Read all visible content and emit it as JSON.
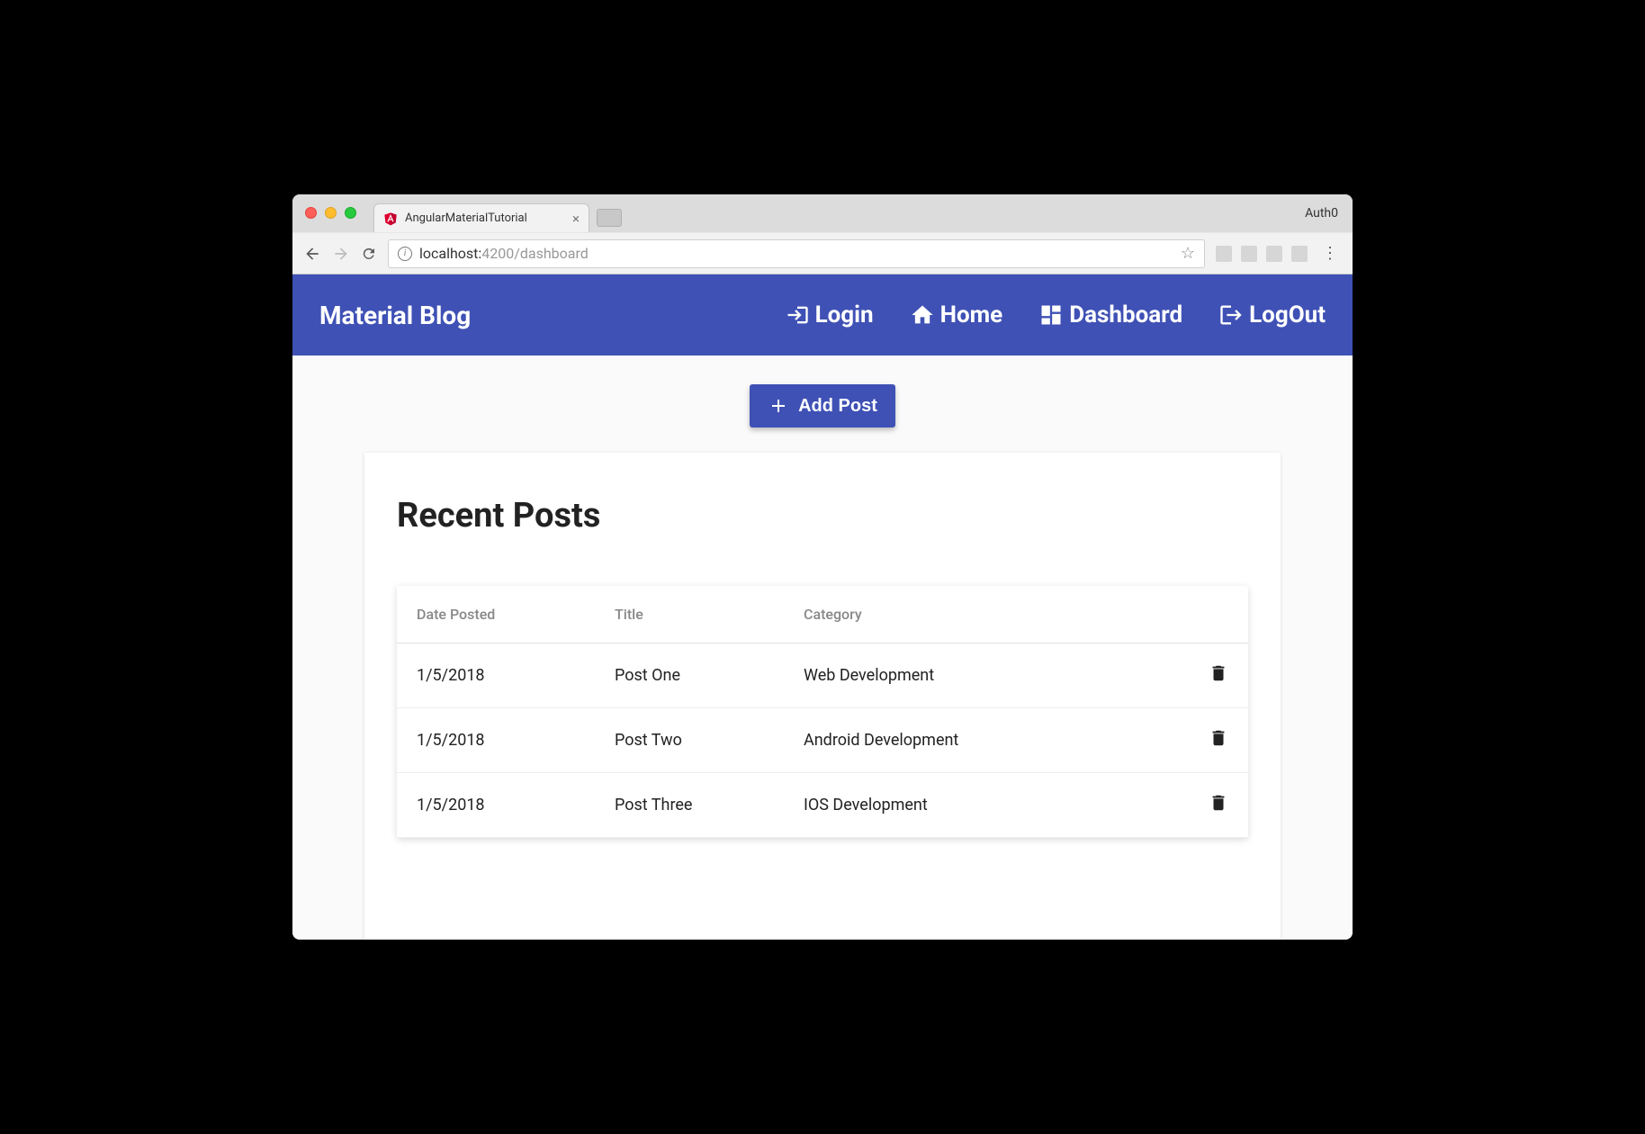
{
  "browser": {
    "tab_title": "AngularMaterialTutorial",
    "profile_label": "Auth0",
    "url_host": "localhost:",
    "url_port": "4200",
    "url_path": "/dashboard"
  },
  "toolbar": {
    "brand": "Material Blog",
    "nav": [
      {
        "label": "Login",
        "icon": "login-icon"
      },
      {
        "label": "Home",
        "icon": "home-icon"
      },
      {
        "label": "Dashboard",
        "icon": "dashboard-icon"
      },
      {
        "label": "LogOut",
        "icon": "logout-icon"
      }
    ]
  },
  "actions": {
    "add_post_label": "Add Post"
  },
  "card": {
    "title": "Recent Posts"
  },
  "table": {
    "headers": {
      "date": "Date Posted",
      "title": "Title",
      "category": "Category"
    },
    "rows": [
      {
        "date": "1/5/2018",
        "title": "Post One",
        "category": "Web Development"
      },
      {
        "date": "1/5/2018",
        "title": "Post Two",
        "category": "Android Development"
      },
      {
        "date": "1/5/2018",
        "title": "Post Three",
        "category": "IOS Development"
      }
    ]
  }
}
